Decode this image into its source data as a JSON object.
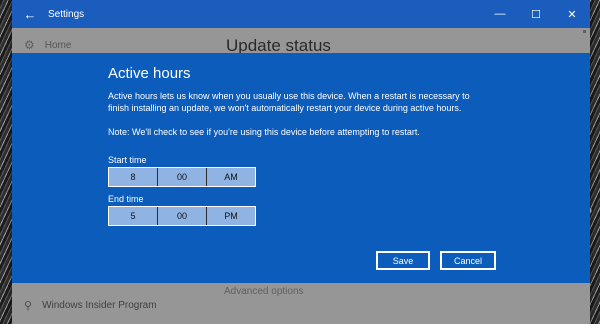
{
  "window": {
    "title": "Settings",
    "back_icon": "back-arrow-icon",
    "controls": [
      "minimize-icon",
      "maximize-icon",
      "close-icon"
    ]
  },
  "sidebar": {
    "home_label": "Home",
    "home_icon": "gear-icon",
    "insider_label": "Windows Insider Program",
    "insider_icon": "person-key-icon"
  },
  "main": {
    "heading": "Update status",
    "advanced_link": "Advanced options"
  },
  "dialog": {
    "title": "Active hours",
    "description": "Active hours lets us know when you usually use this device. When a restart is necessary to finish installing an update, we won't automatically restart your device during active hours.",
    "note": "Note: We'll check to see if you're using this device before attempting to restart.",
    "start_time": {
      "label": "Start time",
      "hour": "8",
      "minute": "00",
      "period": "AM"
    },
    "end_time": {
      "label": "End time",
      "hour": "5",
      "minute": "00",
      "period": "PM"
    },
    "save_label": "Save",
    "cancel_label": "Cancel"
  },
  "colors": {
    "titlebar": "#1a5dbd",
    "dialog_bg": "#0b5cbb",
    "picker_bg": "#8fb3e3"
  }
}
